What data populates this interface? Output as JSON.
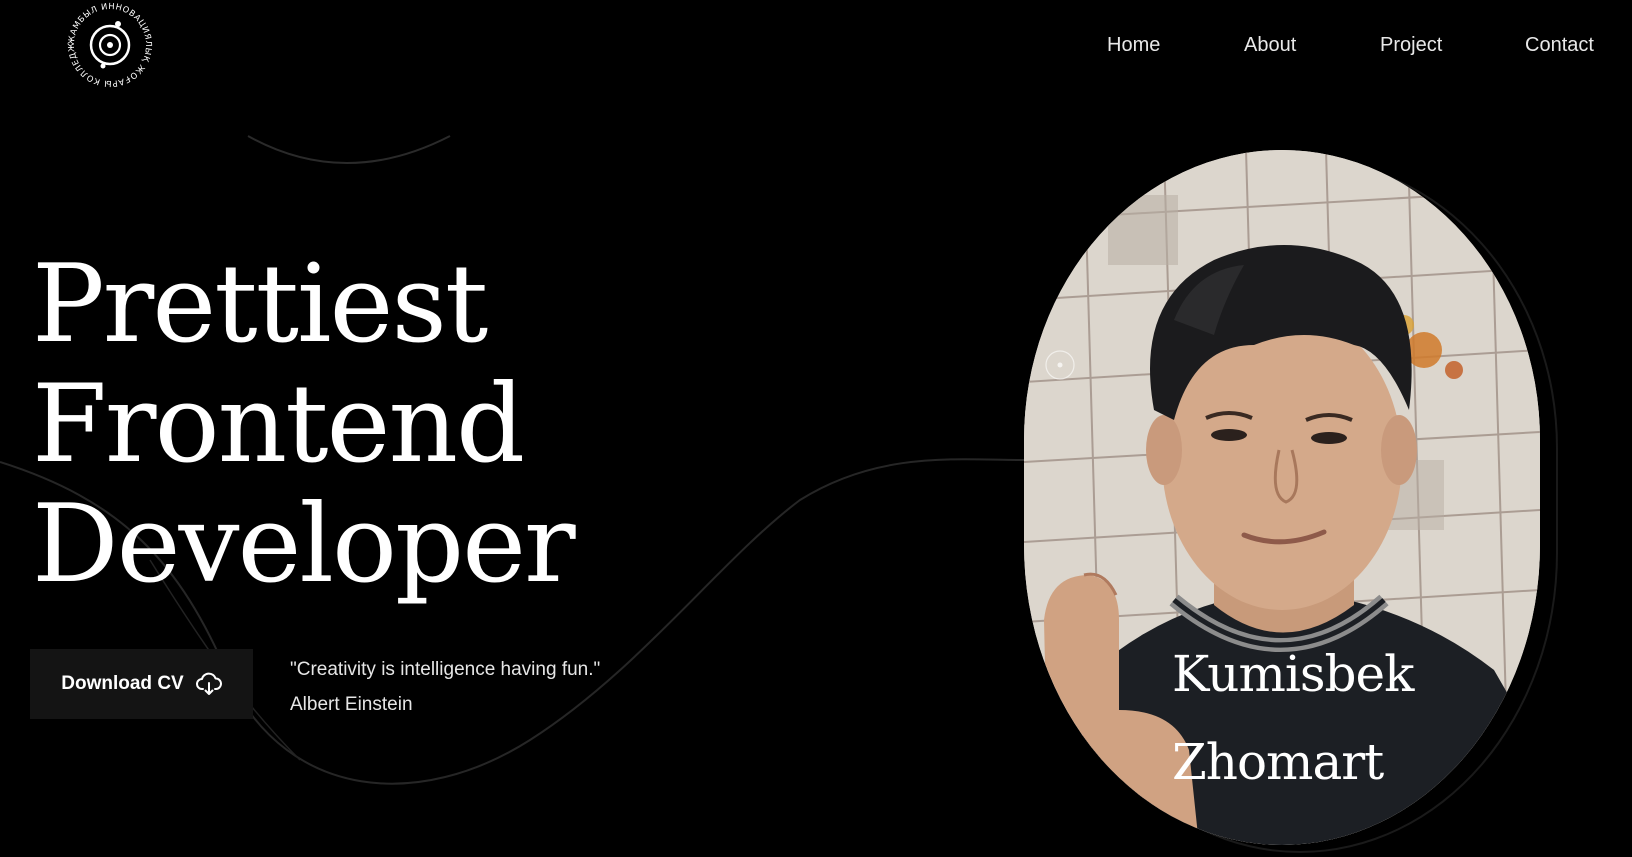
{
  "logo": {
    "ring_text": "ЖАМБЫЛ ИННОВАЦИЯЛЫҚ ЖОҒАРЫ КОЛЛЕДЖІ"
  },
  "nav": {
    "items": [
      {
        "label": "Home"
      },
      {
        "label": "About"
      },
      {
        "label": "Project"
      },
      {
        "label": "Contact"
      }
    ]
  },
  "hero": {
    "title_lines": [
      "Prettiest",
      "Frontend",
      "Developer"
    ]
  },
  "download": {
    "label": "Download CV",
    "icon": "cloud-download-icon"
  },
  "quote": {
    "text": "\"Creativity is intelligence having fun.\"",
    "author": "Albert Einstein"
  },
  "portrait": {
    "name_first": "Kumisbek",
    "name_last": "Zhomart"
  },
  "colors": {
    "background": "#000000",
    "text": "#ffffff",
    "button_bg": "#141414",
    "line": "#2a2a2a"
  }
}
